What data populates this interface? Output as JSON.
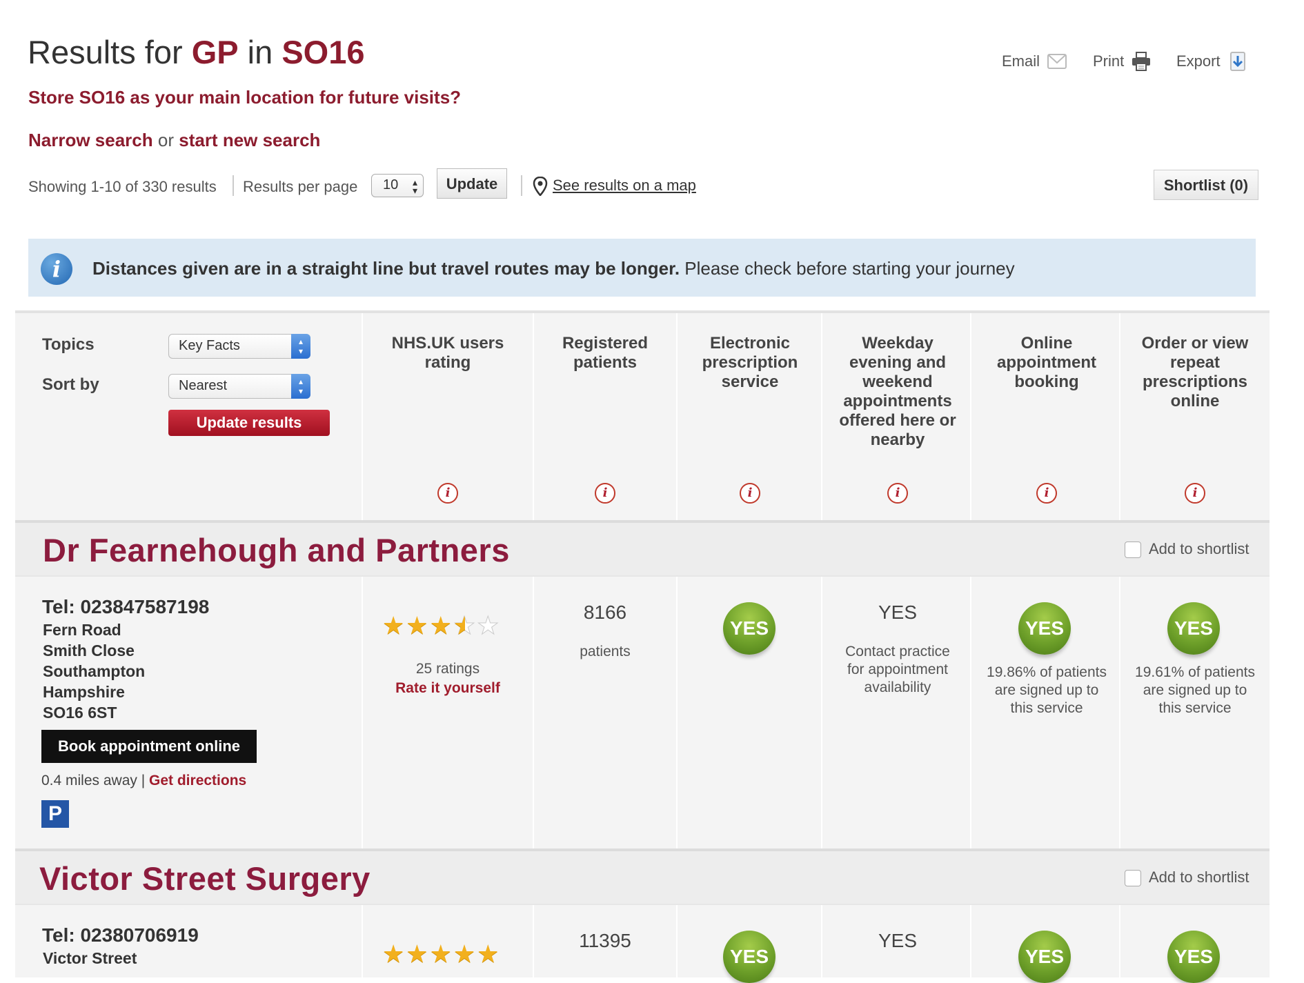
{
  "header": {
    "title_prefix": "Results for ",
    "title_term": "GP",
    "title_mid": " in ",
    "title_location": "SO16",
    "store_prompt": "Store SO16 as your main location for future visits?",
    "narrow_label": "Narrow search",
    "or_label": " or ",
    "new_search_label": "start new search",
    "tools": {
      "email": "Email",
      "print": "Print",
      "export": "Export"
    }
  },
  "results_bar": {
    "showing": "Showing 1-10 of 330 results",
    "per_page_label": "Results per page",
    "per_page_value": "10",
    "update_label": "Update",
    "map_link": "See results on a map",
    "shortlist_label": "Shortlist (0)"
  },
  "banner": {
    "icon": "info-icon",
    "bold_text": "Distances given are in a straight line but travel routes may be longer.",
    "rest_text": " Please check before starting your journey"
  },
  "filters": {
    "topics_label": "Topics",
    "topics_value": "Key Facts",
    "sort_label": "Sort by",
    "sort_value": "Nearest",
    "update_results_label": "Update results"
  },
  "columns": [
    "NHS.UK users rating",
    "Registered patients",
    "Electronic prescription service",
    "Weekday evening and weekend appointments offered here or nearby",
    "Online appointment booking",
    "Order or view repeat prescriptions online"
  ],
  "info_glyph": "i",
  "shortlist_label": "Add to shortlist",
  "practices": [
    {
      "name": "Dr Fearnehough and Partners",
      "tel": "Tel: 023847587198",
      "address": [
        "Fern Road",
        "Smith Close",
        "Southampton",
        "Hampshire",
        "SO16 6ST"
      ],
      "book_label": "Book appointment online",
      "distance": "0.4 miles away | ",
      "directions": "Get directions",
      "parking": "P",
      "rating_stars": 3.5,
      "ratings_count": "25 ratings",
      "rate_link": "Rate it yourself",
      "patients": "8166",
      "patients_label": "patients",
      "eps": "YES",
      "weekday": "YES",
      "weekday_note": "Contact practice for appointment availability",
      "online_booking": "YES",
      "online_booking_note": "19.86% of patients are signed up to this service",
      "repeat_rx": "YES",
      "repeat_rx_note": "19.61% of patients are signed up to this service"
    },
    {
      "name": "Victor Street Surgery",
      "tel": "Tel: 02380706919",
      "address_first": "Victor Street",
      "rating_stars": 5,
      "patients": "11395",
      "eps": "YES",
      "weekday": "YES",
      "online_booking": "YES",
      "repeat_rx": "YES"
    }
  ],
  "colors": {
    "brand": "#8c1c2e",
    "name": "#8c1c3e",
    "yes_green": "#6ea02a",
    "banner_bg": "#dce9f4",
    "star": "#f2b01e"
  }
}
